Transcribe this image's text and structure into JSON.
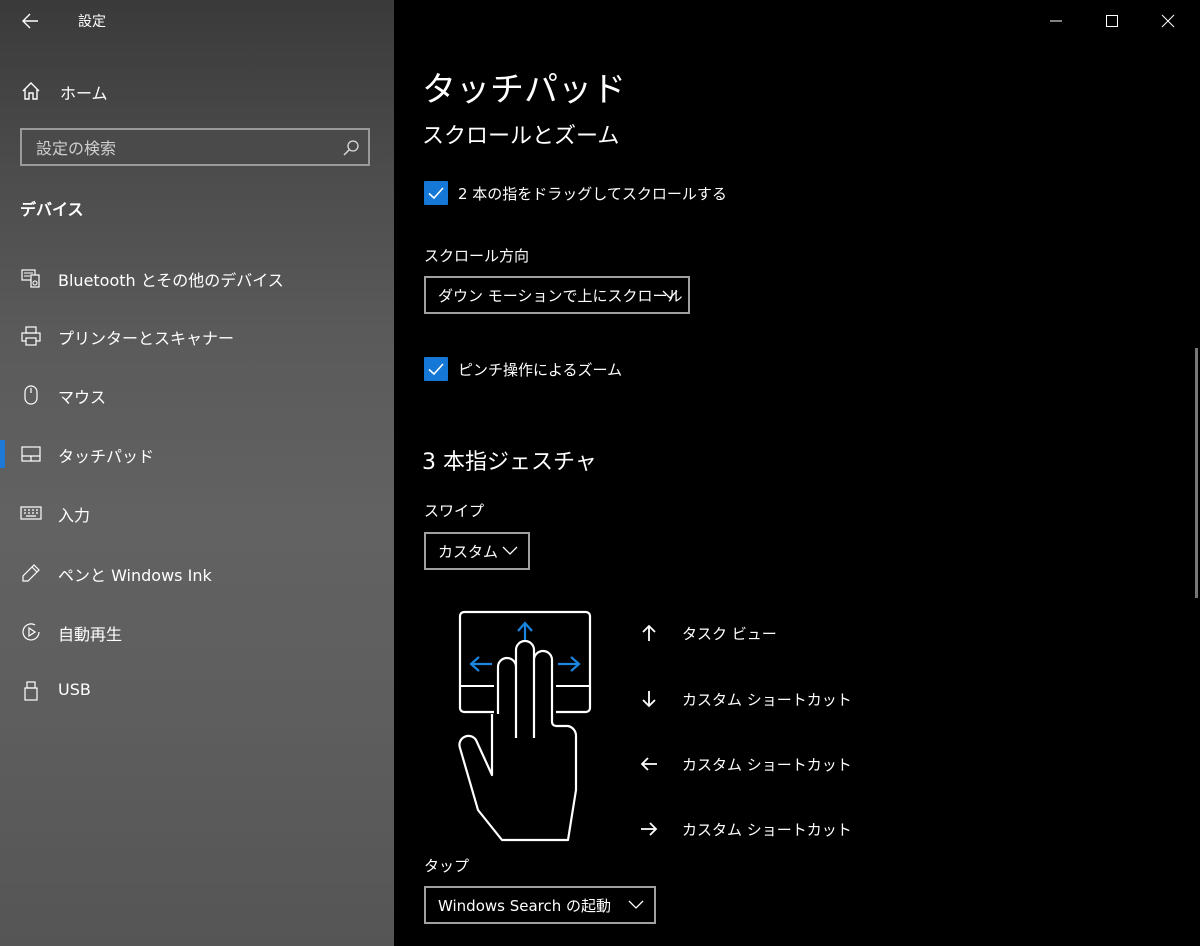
{
  "window": {
    "title": "設定",
    "controls": {
      "minimize_icon": "minimize-icon",
      "maximize_icon": "maximize-icon",
      "close_icon": "close-icon"
    }
  },
  "sidebar": {
    "home_label": "ホーム",
    "search_placeholder": "設定の検索",
    "section_title": "デバイス",
    "items": [
      {
        "label": "Bluetooth とその他のデバイス",
        "icon": "bluetooth-devices-icon",
        "active": false
      },
      {
        "label": "プリンターとスキャナー",
        "icon": "printer-icon",
        "active": false
      },
      {
        "label": "マウス",
        "icon": "mouse-icon",
        "active": false
      },
      {
        "label": "タッチパッド",
        "icon": "touchpad-icon",
        "active": true
      },
      {
        "label": "入力",
        "icon": "keyboard-icon",
        "active": false
      },
      {
        "label": "ペンと Windows Ink",
        "icon": "pen-icon",
        "active": false
      },
      {
        "label": "自動再生",
        "icon": "autoplay-icon",
        "active": false
      },
      {
        "label": "USB",
        "icon": "usb-icon",
        "active": false
      }
    ]
  },
  "main": {
    "page_title": "タッチパッド",
    "scroll_zoom": {
      "heading": "スクロールとズーム",
      "two_finger_scroll": {
        "label": "2 本の指をドラッグしてスクロールする",
        "checked": true
      },
      "scroll_direction_label": "スクロール方向",
      "scroll_direction_value": "ダウン モーションで上にスクロール",
      "pinch_zoom": {
        "label": "ピンチ操作によるズーム",
        "checked": true
      }
    },
    "three_finger": {
      "heading": "3 本指ジェスチャ",
      "swipe_label": "スワイプ",
      "swipe_value": "カスタム",
      "gestures": [
        {
          "direction": "up",
          "icon": "arrow-up-icon",
          "action": "タスク ビュー"
        },
        {
          "direction": "down",
          "icon": "arrow-down-icon",
          "action": "カスタム ショートカット"
        },
        {
          "direction": "left",
          "icon": "arrow-left-icon",
          "action": "カスタム ショートカット"
        },
        {
          "direction": "right",
          "icon": "arrow-right-icon",
          "action": "カスタム ショートカット"
        }
      ],
      "tap_label": "タップ",
      "tap_value": "Windows Search の起動"
    }
  },
  "colors": {
    "accent": "#1577d6",
    "active_bar": "#1e78d8",
    "background": "#000000",
    "arrow_blue": "#1a86e0"
  }
}
